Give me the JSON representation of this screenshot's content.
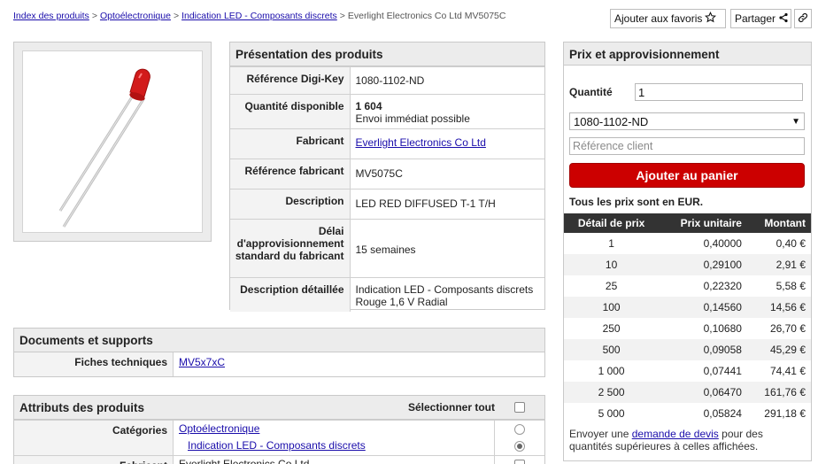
{
  "breadcrumb": {
    "items": [
      "Index des produits",
      "Optoélectronique",
      "Indication LED - Composants discrets"
    ],
    "current": "Everlight Electronics Co Ltd MV5075C",
    "separator": ">"
  },
  "actions": {
    "favorites": "Ajouter aux favoris",
    "share": "Partager"
  },
  "overview": {
    "title": "Présentation des produits",
    "rows": [
      {
        "label": "Référence Digi-Key",
        "value": "1080-1102-ND"
      },
      {
        "label": "Quantité disponible",
        "value": "1 604",
        "sub": "Envoi immédiat possible"
      },
      {
        "label": "Fabricant",
        "value": "Everlight Electronics Co Ltd"
      },
      {
        "label": "Référence fabricant",
        "value": "MV5075C"
      },
      {
        "label": "Description",
        "value": "LED RED DIFFUSED T-1 T/H"
      },
      {
        "label": "Délai d'approvisionnement standard du fabricant",
        "value": "15 semaines"
      },
      {
        "label": "Description détaillée",
        "value": "Indication LED - Composants discrets Rouge 1,6 V Radial"
      }
    ]
  },
  "documents": {
    "title": "Documents et supports",
    "label": "Fiches techniques",
    "value": "MV5x7xC"
  },
  "attributes": {
    "title": "Attributs des produits",
    "select_all": "Sélectionner tout",
    "categories_label": "Catégories",
    "categories": [
      "Optoélectronique",
      "Indication LED - Composants discrets"
    ],
    "next_label": "Fabricant",
    "next_value": "Everlight Electronics Co Ltd"
  },
  "pricing": {
    "title": "Prix et approvisionnement",
    "quantity_label": "Quantité",
    "quantity_value": "1",
    "part_select": "1080-1102-ND",
    "customer_ref_placeholder": "Référence client",
    "add_to_cart": "Ajouter au panier",
    "currency_note": "Tous les prix sont en EUR.",
    "headers": [
      "Détail de prix",
      "Prix unitaire",
      "Montant"
    ],
    "rows": [
      [
        "1",
        "0,40000",
        "0,40 €"
      ],
      [
        "10",
        "0,29100",
        "2,91 €"
      ],
      [
        "25",
        "0,22320",
        "5,58 €"
      ],
      [
        "100",
        "0,14560",
        "14,56 €"
      ],
      [
        "250",
        "0,10680",
        "26,70 €"
      ],
      [
        "500",
        "0,09058",
        "45,29 €"
      ],
      [
        "1 000",
        "0,07441",
        "74,41 €"
      ],
      [
        "2 500",
        "0,06470",
        "161,76 €"
      ],
      [
        "5 000",
        "0,05824",
        "291,18 €"
      ]
    ],
    "note_before": "Envoyer une",
    "note_link": "demande de devis",
    "note_after": "pour des quantités supérieures à celles affichées."
  },
  "colors": {
    "accent_red": "#cc0000",
    "header_dark": "#333333",
    "link_blue": "#1a0dab"
  }
}
